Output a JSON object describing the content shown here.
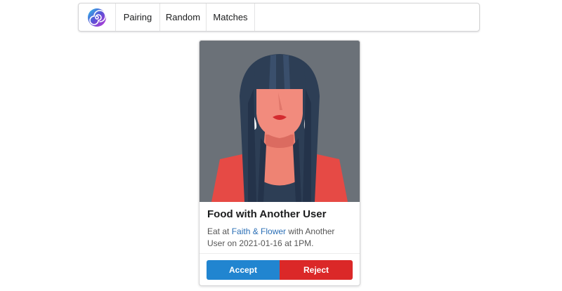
{
  "nav": {
    "logo_icon": "spiral-logo-icon",
    "items": [
      {
        "label": "Pairing"
      },
      {
        "label": "Random"
      },
      {
        "label": "Matches"
      }
    ]
  },
  "card": {
    "image_icon": "woman-avatar-illustration",
    "title": "Food with Another User",
    "desc_prefix": "Eat at ",
    "restaurant": "Faith & Flower",
    "desc_middle": " with Another User on 2021-01-16 at 1PM.",
    "accept_label": "Accept",
    "reject_label": "Reject"
  },
  "colors": {
    "accept": "#2185d0",
    "reject": "#db2828",
    "link": "#2b6fb6",
    "image_bg": "#6b7178"
  }
}
